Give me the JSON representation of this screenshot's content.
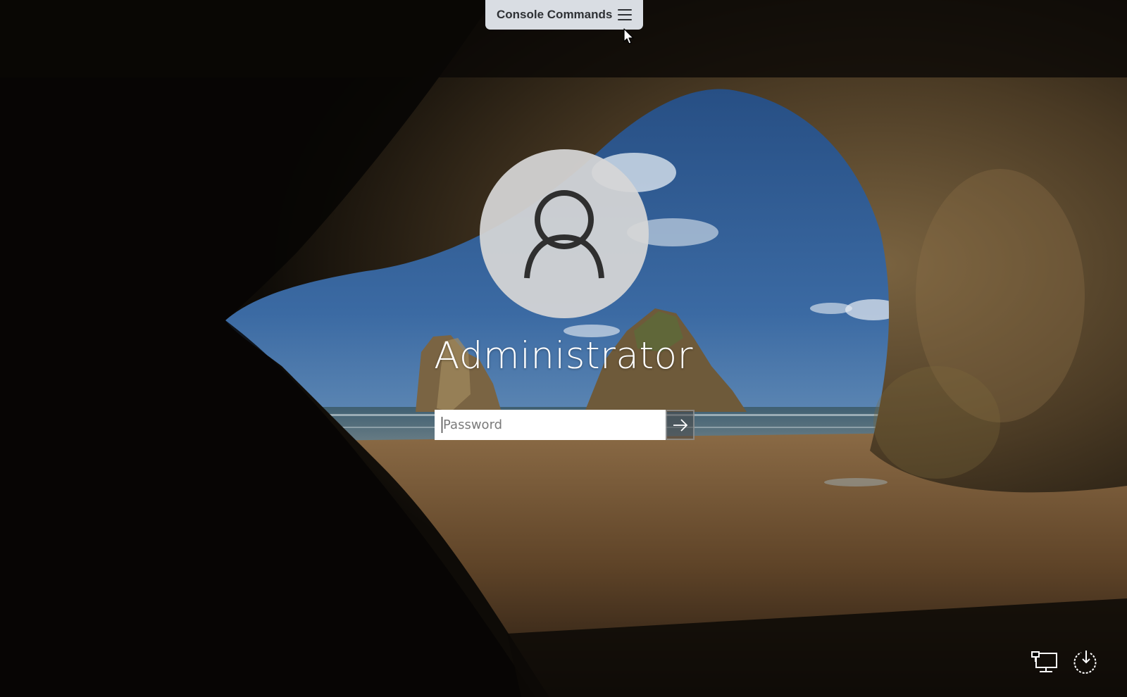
{
  "toolbar": {
    "console_label": "Console Commands",
    "menu_icon": "hamburger-menu-icon"
  },
  "login": {
    "username": "Administrator",
    "password_placeholder": "Password",
    "password_value": "",
    "avatar_icon": "user-silhouette-icon",
    "submit_icon": "arrow-right-icon"
  },
  "corner_controls": {
    "network_icon": "network-icon",
    "power_icon": "power-icon"
  },
  "colors": {
    "console_bar": "#d9dde3",
    "console_text": "#2e3135",
    "avatar_bg": "#d6d6d6",
    "username_text": "#ffffff"
  }
}
